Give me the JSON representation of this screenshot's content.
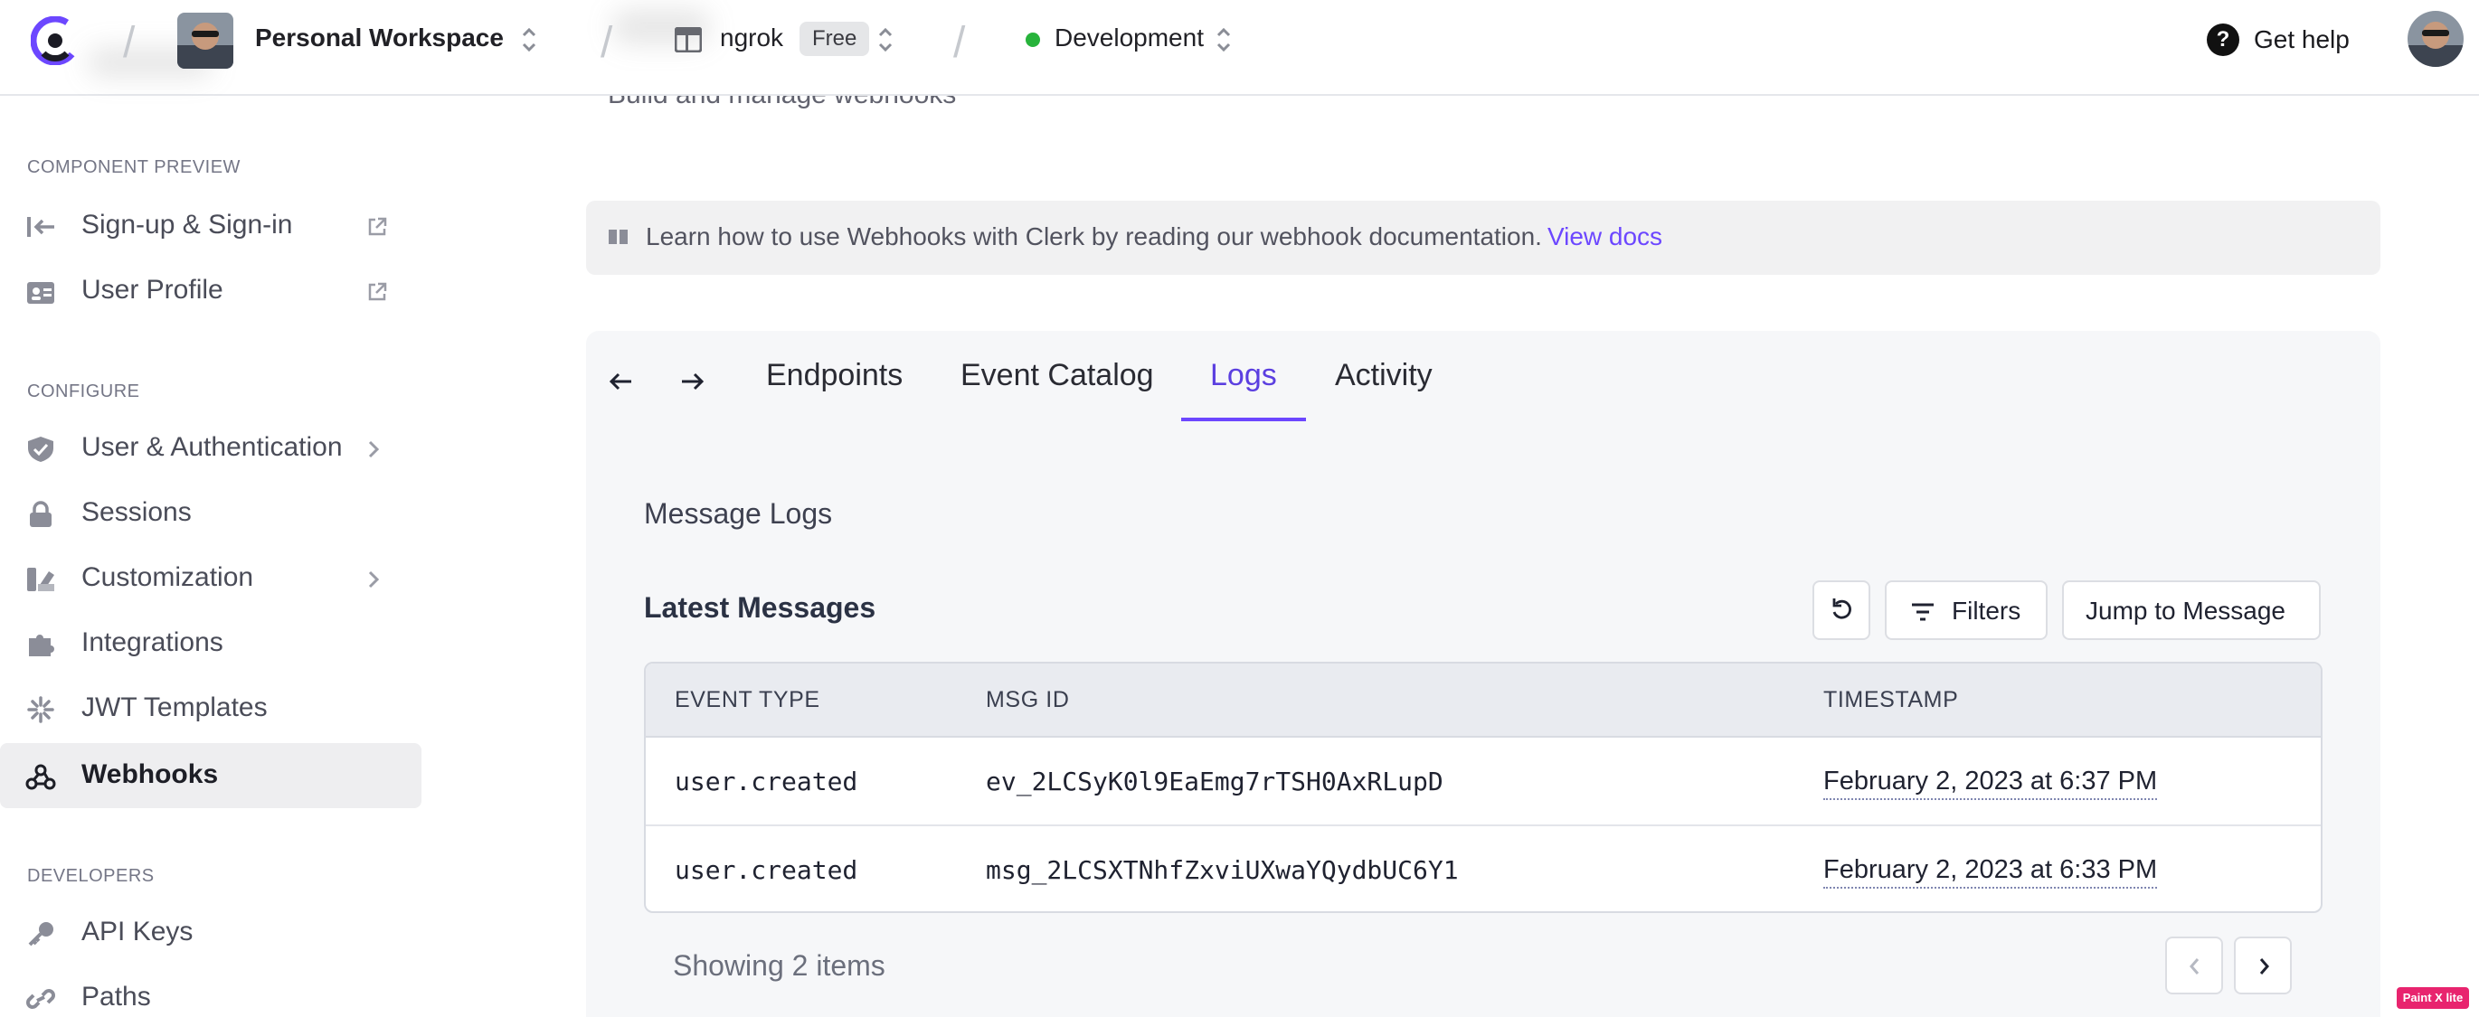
{
  "topbar": {
    "workspace_name": "Personal Workspace",
    "app_name": "ngrok",
    "plan_badge": "Free",
    "environment": "Development",
    "help_label": "Get help"
  },
  "header": {
    "subtitle": "Build and manage webhooks"
  },
  "sidebar": {
    "sections": [
      {
        "label": "COMPONENT PREVIEW"
      },
      {
        "label": "CONFIGURE"
      },
      {
        "label": "DEVELOPERS"
      }
    ],
    "items": [
      {
        "label": "Sign-up & Sign-in",
        "icon": "sign-in-icon",
        "extra": "external-link-icon"
      },
      {
        "label": "User Profile",
        "icon": "user-card-icon",
        "extra": "external-link-icon"
      },
      {
        "label": "User & Authentication",
        "icon": "shield-check-icon",
        "extra": "chevron-right-icon"
      },
      {
        "label": "Sessions",
        "icon": "lock-icon"
      },
      {
        "label": "Customization",
        "icon": "paint-brush-icon",
        "extra": "chevron-right-icon"
      },
      {
        "label": "Integrations",
        "icon": "puzzle-icon"
      },
      {
        "label": "JWT Templates",
        "icon": "jwt-icon"
      },
      {
        "label": "Webhooks",
        "icon": "webhook-icon",
        "active": true
      },
      {
        "label": "API Keys",
        "icon": "key-icon"
      },
      {
        "label": "Paths",
        "icon": "link-icon"
      }
    ]
  },
  "banner": {
    "text": "Learn how to use Webhooks with Clerk by reading our webhook documentation.",
    "link": "View docs"
  },
  "tabs": [
    {
      "label": "Endpoints"
    },
    {
      "label": "Event Catalog"
    },
    {
      "label": "Logs",
      "active": true
    },
    {
      "label": "Activity"
    }
  ],
  "logs": {
    "title": "Message Logs",
    "section_title": "Latest Messages",
    "filters_label": "Filters",
    "jump_label": "Jump to Message",
    "columns": [
      "EVENT TYPE",
      "MSG ID",
      "TIMESTAMP"
    ],
    "rows": [
      {
        "event_type": "user.created",
        "msg_id": "ev_2LCSyK0l9EaEmg7rTSH0AxRLupD",
        "timestamp": "February 2, 2023 at 6:37 PM"
      },
      {
        "event_type": "user.created",
        "msg_id": "msg_2LCSXTNhfZxviUXwaYQydbUC6Y1",
        "timestamp": "February 2, 2023 at 6:33 PM"
      }
    ],
    "showing": "Showing 2 items"
  },
  "watermark": "Paint X lite",
  "colors": {
    "accent": "#6c47ff",
    "env_status": "#27b33b"
  }
}
